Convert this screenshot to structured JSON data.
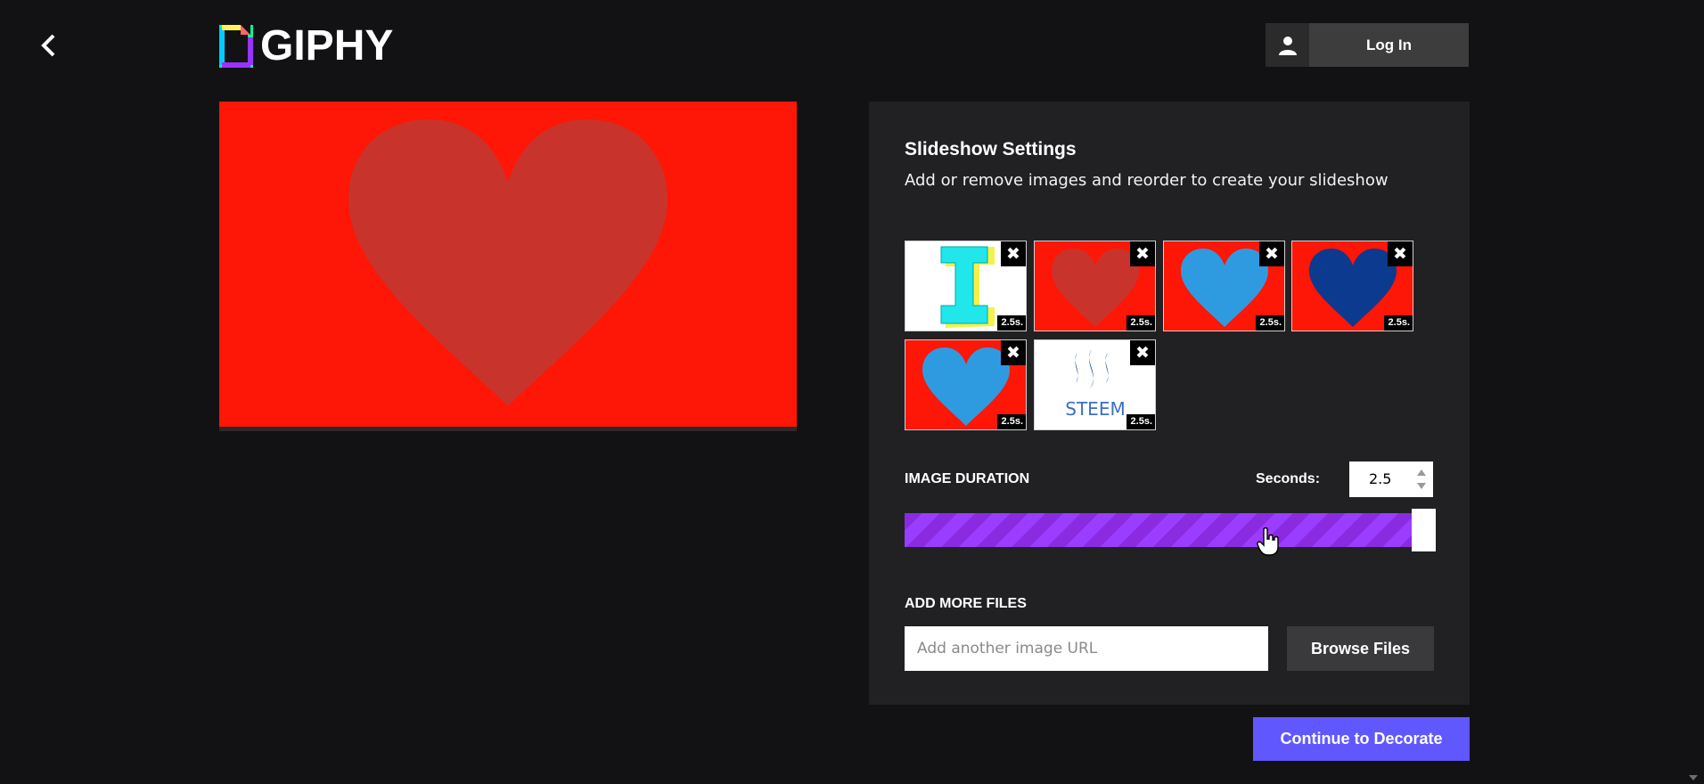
{
  "header": {
    "logo_text": "GIPHY",
    "login_label": "Log In"
  },
  "panel": {
    "title": "Slideshow Settings",
    "subtitle": "Add or remove images and reorder to create your slideshow",
    "thumbnails": [
      {
        "kind": "letter-i",
        "duration": "2.5s."
      },
      {
        "kind": "heart",
        "heart_color": "#c8342b",
        "bg": "#fe1606",
        "duration": "2.5s."
      },
      {
        "kind": "heart",
        "heart_color": "#2e9be0",
        "bg": "#fe1606",
        "duration": "2.5s."
      },
      {
        "kind": "heart",
        "heart_color": "#0b3a8f",
        "bg": "#fe1606",
        "duration": "2.5s."
      },
      {
        "kind": "heart",
        "heart_color": "#2e9be0",
        "bg": "#fe1606",
        "duration": "2.5s."
      },
      {
        "kind": "steem",
        "label": "STEEM",
        "duration": "2.5s."
      }
    ],
    "image_duration": {
      "label": "IMAGE DURATION",
      "seconds_label": "Seconds:",
      "seconds_value": "2.5",
      "slider_fraction": 0.95
    },
    "add_files": {
      "label": "ADD MORE FILES",
      "url_placeholder": "Add another image URL",
      "browse_label": "Browse Files"
    }
  },
  "continue_label": "Continue to Decorate",
  "colors": {
    "background": "#121215",
    "panel": "#212124",
    "preview_bg": "#fe1606",
    "preview_heart": "#c8342b",
    "accent_purple": "#9933ff",
    "continue_button": "#6157ff"
  }
}
